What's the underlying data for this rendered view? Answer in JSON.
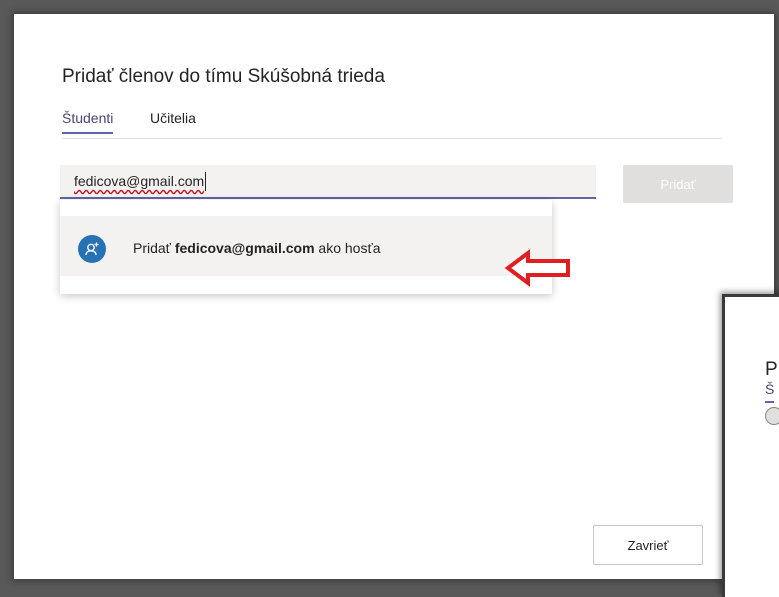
{
  "dialog": {
    "title": "Pridať členov do tímu Skúšobná trieda",
    "tabs": [
      {
        "label": "Študenti",
        "active": true
      },
      {
        "label": "Učitelia",
        "active": false
      }
    ],
    "search": {
      "value": "fedicova@gmail.com"
    },
    "add_button_label": "Pridať",
    "suggestion": {
      "prefix": "Pridať ",
      "email": "fedicova@gmail.com",
      "suffix": " ako hosťa",
      "icon": "add-guest-icon"
    },
    "close_button_label": "Zavrieť"
  },
  "overlay_dialog": {
    "title_fragment": "P",
    "tab_fragment": "Š"
  },
  "colors": {
    "accent": "#6264a7",
    "guest_icon": "#2672b5",
    "annotation_arrow": "#e02020"
  }
}
